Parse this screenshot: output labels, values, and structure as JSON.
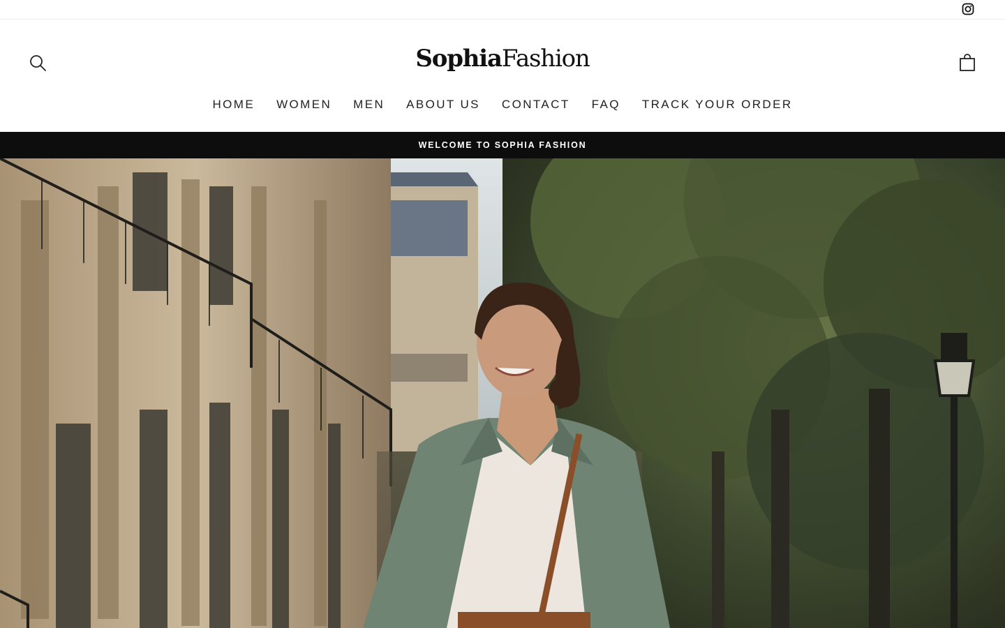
{
  "topbar": {
    "social_icon": "instagram-icon"
  },
  "header": {
    "search_icon": "search-icon",
    "cart_icon": "shopping-bag-icon",
    "logo": {
      "bold": "Sophia",
      "light": "Fashion"
    }
  },
  "nav": {
    "items": [
      {
        "label": "HOME"
      },
      {
        "label": "WOMEN"
      },
      {
        "label": "MEN"
      },
      {
        "label": "ABOUT US"
      },
      {
        "label": "CONTACT"
      },
      {
        "label": "FAQ"
      },
      {
        "label": "TRACK YOUR ORDER"
      }
    ]
  },
  "announcement": {
    "text": "WELCOME TO SOPHIA FASHION"
  },
  "hero": {
    "image": "hero-photo-woman-walking-street",
    "colors": {
      "sky": "#cfd6da",
      "building": "#c8b79c",
      "trees": "#3f4a2f",
      "blazer": "#6f8472",
      "blouse": "#ece6de",
      "strap": "#8a4e28"
    }
  },
  "colors": {
    "announcement_bg": "#0d0d0d",
    "text": "#111111",
    "background": "#ffffff"
  }
}
